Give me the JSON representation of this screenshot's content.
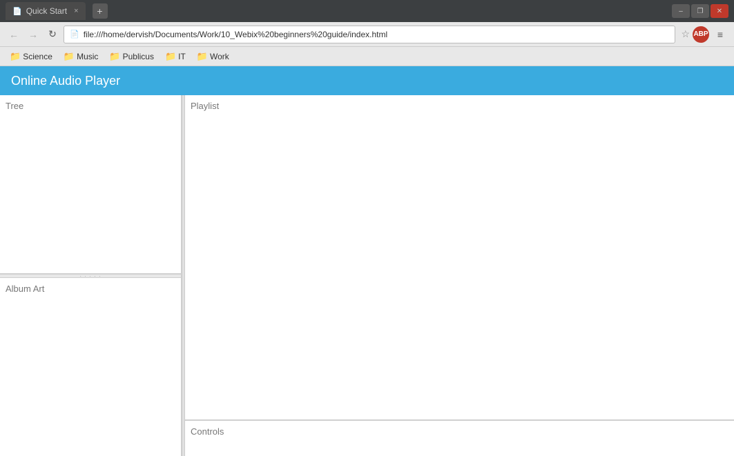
{
  "titlebar": {
    "tab_label": "Quick Start",
    "tab_icon": "📄",
    "tab_close": "×",
    "new_tab_label": "+",
    "wc_minimize": "–",
    "wc_restore": "❐",
    "wc_close": "✕"
  },
  "navbar": {
    "back_label": "←",
    "forward_label": "→",
    "reload_label": "↻",
    "address": "file:///home/dervish/Documents/Work/10_Webix%20beginners%20guide/index.html",
    "address_icon": "📄",
    "star_label": "☆",
    "abp_label": "ABP",
    "menu_label": "≡"
  },
  "bookmarks": {
    "items": [
      {
        "label": "Science",
        "icon": "📁"
      },
      {
        "label": "Music",
        "icon": "📁"
      },
      {
        "label": "Publicus",
        "icon": "📁"
      },
      {
        "label": "IT",
        "icon": "📁"
      },
      {
        "label": "Work",
        "icon": "📁"
      }
    ]
  },
  "app": {
    "title": "Online Audio Player",
    "tree_label": "Tree",
    "album_label": "Album Art",
    "playlist_label": "Playlist",
    "controls_label": "Controls"
  }
}
